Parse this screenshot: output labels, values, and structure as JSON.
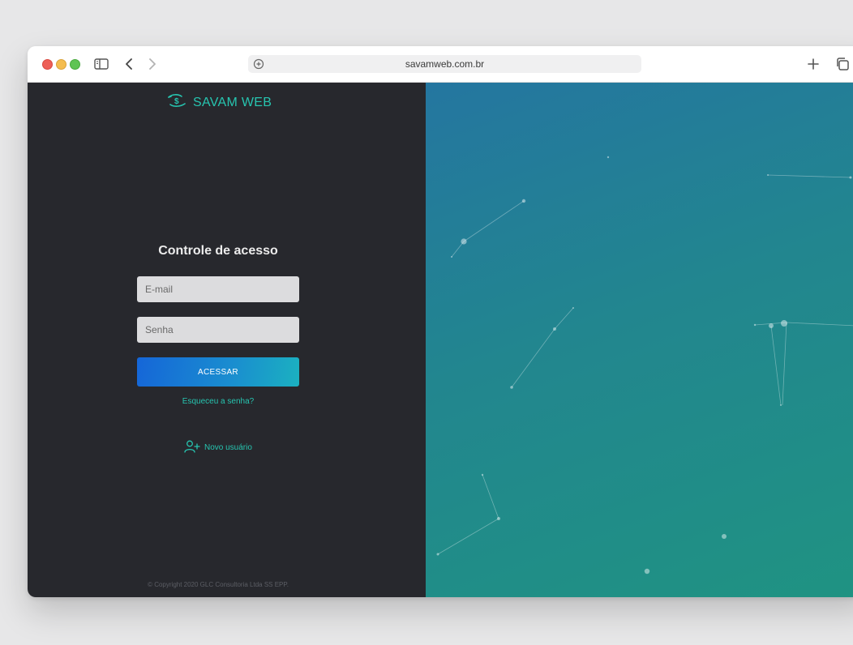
{
  "browser": {
    "url": "savamweb.com.br",
    "icons": [
      "sidebar-toggle-icon",
      "back-arrow-icon",
      "forward-arrow-icon",
      "site-settings-icon",
      "new-tab-plus-icon",
      "tabs-overview-icon"
    ]
  },
  "brand": {
    "name": "SAVAM WEB",
    "logo_icon": "hand-dollar-icon",
    "color": "#27c5b0"
  },
  "login": {
    "title": "Controle de acesso",
    "email_placeholder": "E-mail",
    "email_value": "",
    "password_placeholder": "Senha",
    "password_value": "",
    "submit_label": "ACESSAR",
    "forgot_label": "Esqueceu a senha?",
    "new_user_label": "Novo usuário",
    "new_user_icon": "user-plus-icon"
  },
  "footer": {
    "copyright": "© Copyright 2020 GLC Consultoria Ltda SS EPP."
  },
  "colors": {
    "left_panel": "#27282d",
    "accent": "#27c5b0",
    "button_start": "#1566d8",
    "button_end": "#1bb1c0",
    "right_gradient_start": "#2476a0",
    "right_gradient_end": "#1f9382"
  }
}
